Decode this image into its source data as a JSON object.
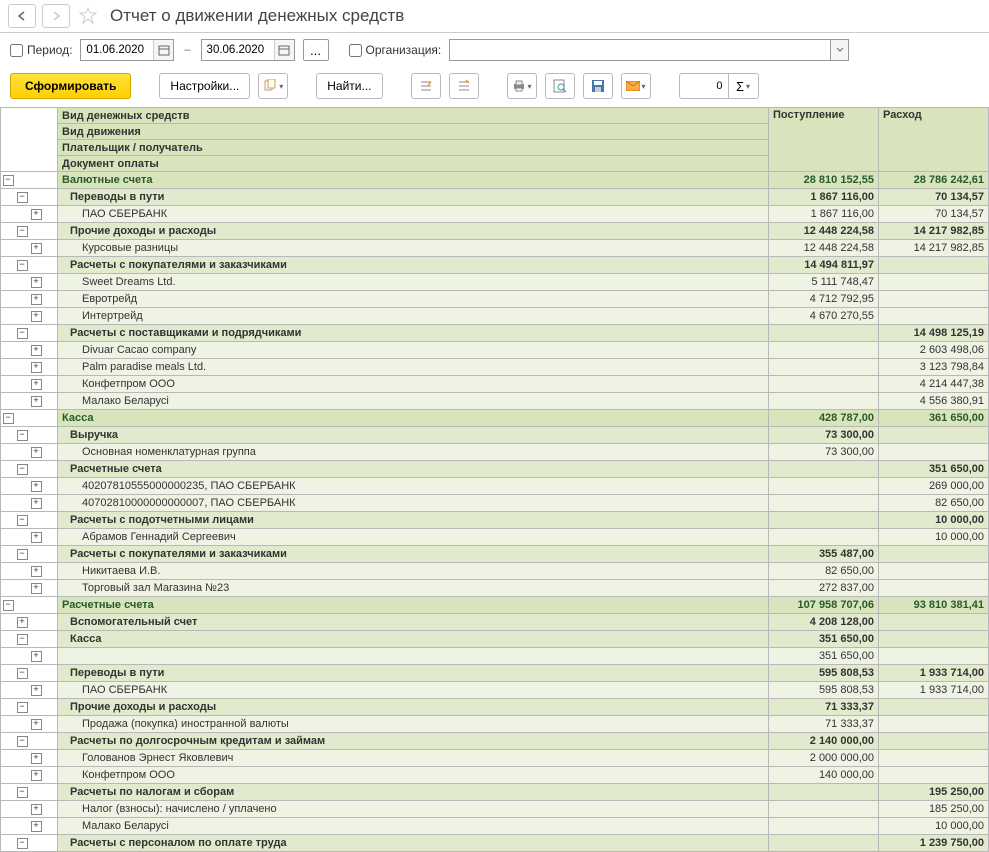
{
  "title": "Отчет о движении денежных средств",
  "period_label": "Период:",
  "date_from": "01.06.2020",
  "date_to": "30.06.2020",
  "dash": "–",
  "org_label": "Организация:",
  "btn_form": "Сформировать",
  "btn_settings": "Настройки...",
  "btn_find": "Найти...",
  "num_value": "0",
  "headers": {
    "c1a": "Вид денежных средств",
    "c1b": "Вид движения",
    "c1c": "Плательщик / получатель",
    "c1d": "Документ оплаты",
    "c2": "Поступление",
    "c3": "Расход"
  },
  "rows": [
    {
      "level": 0,
      "tree": "0m",
      "name": "Валютные счета",
      "in": "28 810 152,55",
      "out": "28 786 242,61"
    },
    {
      "level": 1,
      "tree": "1m",
      "name": "Переводы в пути",
      "in": "1 867 116,00",
      "out": "70 134,57"
    },
    {
      "level": 2,
      "tree": "2p",
      "name": "ПАО СБЕРБАНК",
      "in": "1 867 116,00",
      "out": "70 134,57"
    },
    {
      "level": 1,
      "tree": "1m",
      "name": "Прочие доходы и расходы",
      "in": "12 448 224,58",
      "out": "14 217 982,85"
    },
    {
      "level": 2,
      "tree": "2p",
      "name": "Курсовые разницы",
      "in": "12 448 224,58",
      "out": "14 217 982,85"
    },
    {
      "level": 1,
      "tree": "1m",
      "name": "Расчеты с покупателями и заказчиками",
      "in": "14 494 811,97",
      "out": ""
    },
    {
      "level": 2,
      "tree": "2p",
      "name": "Sweet Dreams Ltd.",
      "in": "5 111 748,47",
      "out": ""
    },
    {
      "level": 2,
      "tree": "2p",
      "name": "Евротрейд",
      "in": "4 712 792,95",
      "out": ""
    },
    {
      "level": 2,
      "tree": "2p",
      "name": "Интертрейд",
      "in": "4 670 270,55",
      "out": ""
    },
    {
      "level": 1,
      "tree": "1m",
      "name": "Расчеты с поставщиками и подрядчиками",
      "in": "",
      "out": "14 498 125,19"
    },
    {
      "level": 2,
      "tree": "2p",
      "name": "Divuar Cacao company",
      "in": "",
      "out": "2 603 498,06"
    },
    {
      "level": 2,
      "tree": "2p",
      "name": "Palm paradise meals Ltd.",
      "in": "",
      "out": "3 123 798,84"
    },
    {
      "level": 2,
      "tree": "2p",
      "name": "Конфетпром ООО",
      "in": "",
      "out": "4 214 447,38"
    },
    {
      "level": 2,
      "tree": "2p",
      "name": "Малако Беларусі",
      "in": "",
      "out": "4 556 380,91"
    },
    {
      "level": 0,
      "tree": "0m",
      "name": "Касса",
      "in": "428 787,00",
      "out": "361 650,00"
    },
    {
      "level": 1,
      "tree": "1m",
      "name": "Выручка",
      "in": "73 300,00",
      "out": ""
    },
    {
      "level": 2,
      "tree": "2p",
      "name": "Основная номенклатурная группа",
      "in": "73 300,00",
      "out": ""
    },
    {
      "level": 1,
      "tree": "1m",
      "name": "Расчетные счета",
      "in": "",
      "out": "351 650,00"
    },
    {
      "level": 2,
      "tree": "2p",
      "name": "40207810555000000235, ПАО СБЕРБАНК",
      "in": "",
      "out": "269 000,00"
    },
    {
      "level": 2,
      "tree": "2p",
      "name": "40702810000000000007, ПАО СБЕРБАНК",
      "in": "",
      "out": "82 650,00"
    },
    {
      "level": 1,
      "tree": "1m",
      "name": "Расчеты с подотчетными лицами",
      "in": "",
      "out": "10 000,00"
    },
    {
      "level": 2,
      "tree": "2p",
      "name": "Абрамов Геннадий Сергеевич",
      "in": "",
      "out": "10 000,00"
    },
    {
      "level": 1,
      "tree": "1m",
      "name": "Расчеты с покупателями и заказчиками",
      "in": "355 487,00",
      "out": ""
    },
    {
      "level": 2,
      "tree": "2p",
      "name": "Никитаева И.В.",
      "in": "82 650,00",
      "out": ""
    },
    {
      "level": 2,
      "tree": "2p",
      "name": "Торговый зал Магазина №23",
      "in": "272 837,00",
      "out": ""
    },
    {
      "level": 0,
      "tree": "0m",
      "name": "Расчетные счета",
      "in": "107 958 707,06",
      "out": "93 810 381,41"
    },
    {
      "level": 1,
      "tree": "1p",
      "name": "Вспомогательный счет",
      "in": "4 208 128,00",
      "out": ""
    },
    {
      "level": 1,
      "tree": "1m",
      "name": "Касса",
      "in": "351 650,00",
      "out": ""
    },
    {
      "level": 2,
      "tree": "2p",
      "name": "",
      "in": "351 650,00",
      "out": ""
    },
    {
      "level": 1,
      "tree": "1m",
      "name": "Переводы в пути",
      "in": "595 808,53",
      "out": "1 933 714,00"
    },
    {
      "level": 2,
      "tree": "2p",
      "name": "ПАО СБЕРБАНК",
      "in": "595 808,53",
      "out": "1 933 714,00"
    },
    {
      "level": 1,
      "tree": "1m",
      "name": "Прочие доходы и расходы",
      "in": "71 333,37",
      "out": ""
    },
    {
      "level": 2,
      "tree": "2p",
      "name": "Продажа (покупка) иностранной валюты",
      "in": "71 333,37",
      "out": ""
    },
    {
      "level": 1,
      "tree": "1m",
      "name": "Расчеты по долгосрочным кредитам и займам",
      "in": "2 140 000,00",
      "out": ""
    },
    {
      "level": 2,
      "tree": "2p",
      "name": "Голованов Эрнест Яковлевич",
      "in": "2 000 000,00",
      "out": ""
    },
    {
      "level": 2,
      "tree": "2p",
      "name": "Конфетпром ООО",
      "in": "140 000,00",
      "out": ""
    },
    {
      "level": 1,
      "tree": "1m",
      "name": "Расчеты по налогам и сборам",
      "in": "",
      "out": "195 250,00"
    },
    {
      "level": 2,
      "tree": "2p",
      "name": "Налог (взносы): начислено / уплачено",
      "in": "",
      "out": "185 250,00"
    },
    {
      "level": 2,
      "tree": "2p",
      "name": "Малако Беларусі",
      "in": "",
      "out": "10 000,00"
    },
    {
      "level": 1,
      "tree": "1m",
      "name": "Расчеты с персоналом по оплате труда",
      "in": "",
      "out": "1 239 750,00"
    }
  ]
}
